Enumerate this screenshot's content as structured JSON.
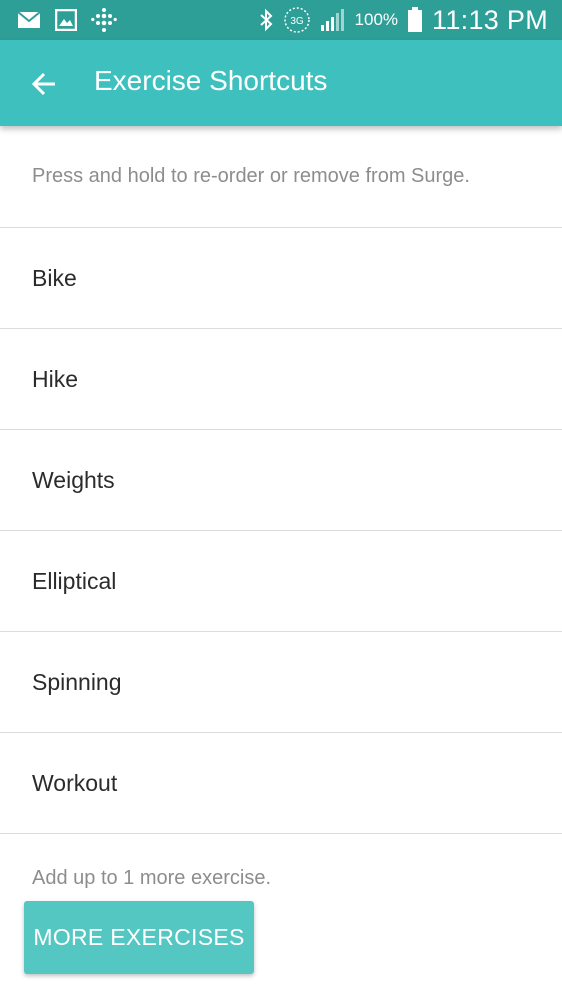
{
  "status_bar": {
    "icons_left": [
      "mail-icon",
      "image-icon",
      "fitbit-icon"
    ],
    "icons_right": [
      "bluetooth-icon",
      "3g-icon",
      "signal-icon",
      "battery-icon"
    ],
    "network_label": "3G",
    "battery": "100%",
    "time": "11:13 PM"
  },
  "app_bar": {
    "title": "Exercise Shortcuts",
    "back_icon": "arrow-left-icon"
  },
  "hint": "Press and hold to re-order or remove from Surge.",
  "exercises": [
    {
      "label": "Bike"
    },
    {
      "label": "Hike"
    },
    {
      "label": "Weights"
    },
    {
      "label": "Elliptical"
    },
    {
      "label": "Spinning"
    },
    {
      "label": "Workout"
    }
  ],
  "footer": {
    "note": "Add up to 1 more exercise.",
    "button_label": "MORE EXERCISES"
  },
  "colors": {
    "status_bar": "#2e9f97",
    "app_bar": "#3ec1be",
    "button": "#55c7c3",
    "hint_text": "#8d8d8d",
    "item_text": "#2b2b2b"
  }
}
